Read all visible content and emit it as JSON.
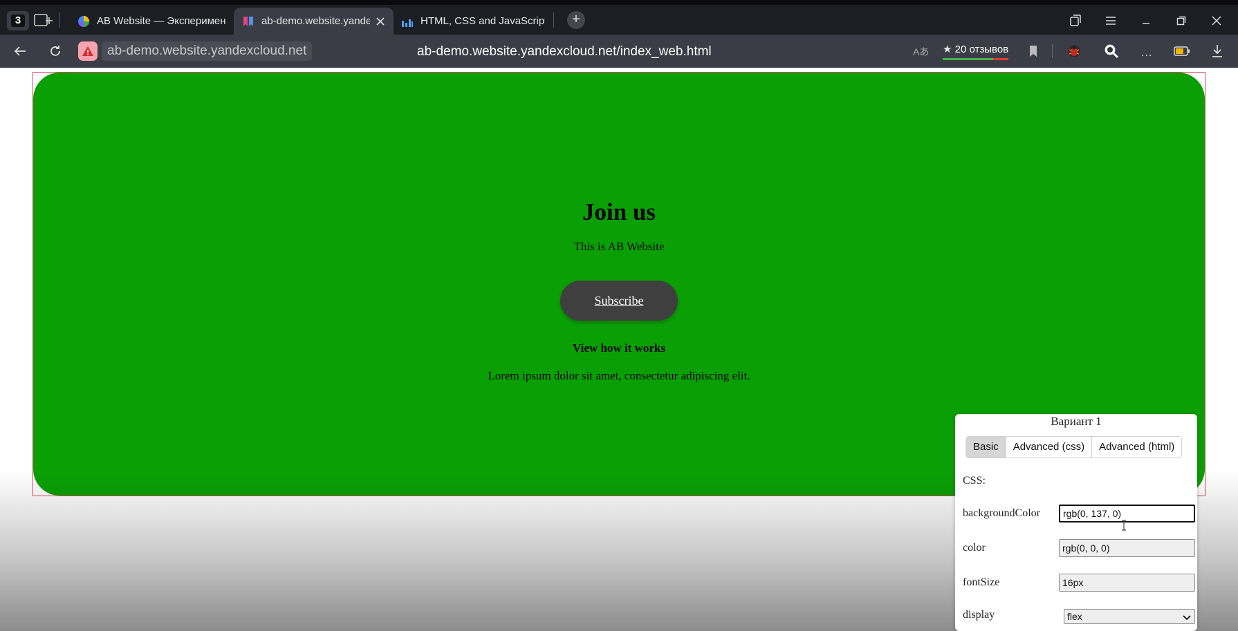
{
  "browser": {
    "tab_count": "3",
    "tabs": [
      {
        "title": "AB Website — Эксперимен"
      },
      {
        "title": "ab-demo.website.yandex"
      },
      {
        "title": "HTML, CSS and JavaScript o"
      }
    ],
    "address": {
      "domain": "ab-demo.website.yandexcloud.net",
      "url": "ab-demo.website.yandexcloud.net/index_web.html"
    },
    "translate_label": "Aあ",
    "reviews_label": "20 отзывов",
    "more_label": "..."
  },
  "hero": {
    "title": "Join us",
    "subtitle": "This is AB Website",
    "button_label": "Subscribe",
    "how_label": "View how it works",
    "lorem": "Lorem ipsum dolor sit amet, consectetur adipiscing elit."
  },
  "panel": {
    "title": "Вариант 1",
    "tabs": [
      "Basic",
      "Advanced (css)",
      "Advanced (html)"
    ],
    "css_label": "CSS:",
    "fields": [
      {
        "label": "backgroundColor",
        "value": "rgb(0, 137, 0)"
      },
      {
        "label": "color",
        "value": "rgb(0, 0, 0)"
      },
      {
        "label": "fontSize",
        "value": "16px"
      }
    ],
    "display": {
      "label": "display",
      "value": "flex"
    }
  },
  "colors": {
    "hero_bg": "#0aa005",
    "chrome_dark": "#1d1e23",
    "chrome_mid": "#3b3d46",
    "button_bg": "#3f3f3f"
  }
}
